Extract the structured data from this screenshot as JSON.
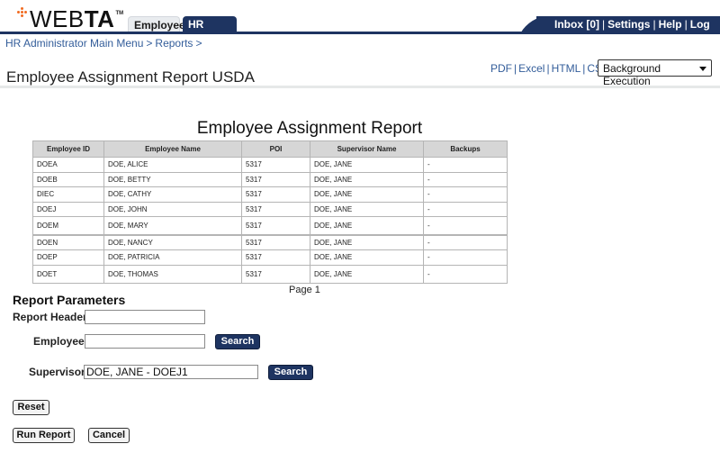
{
  "header": {
    "logo_text_thin": "WEB",
    "logo_text_bold": "TA",
    "logo_tm": "TM",
    "tabs": [
      {
        "label": "Employee",
        "active": false
      },
      {
        "label": "HR Admin",
        "active": true
      }
    ],
    "utility_links": [
      "Inbox [0]",
      "Settings",
      "Help",
      "Log Out"
    ],
    "separator": "|",
    "colors": {
      "navy": "#1e3461",
      "logo_orange": "#f26b21",
      "link_blue": "#335d9a"
    }
  },
  "breadcrumb": {
    "items": [
      "HR Administrator Main Menu",
      "Reports"
    ],
    "separator": ">"
  },
  "page_title": "Employee Assignment Report USDA",
  "exports": {
    "links": [
      "PDF",
      "Excel",
      "HTML",
      "CSV"
    ],
    "separator": "|",
    "execution_select": {
      "selected": "Background Execution"
    }
  },
  "report": {
    "title": "Employee Assignment Report",
    "columns": [
      "Employee ID",
      "Employee Name",
      "POI",
      "Supervisor Name",
      "Backups"
    ],
    "rows": [
      [
        "DOEA",
        "DOE, ALICE",
        "5317",
        "DOE, JANE",
        "-"
      ],
      [
        "DOEB",
        "DOE, BETTY",
        "5317",
        "DOE, JANE",
        "-"
      ],
      [
        "DIEC",
        "DOE, CATHY",
        "5317",
        "DOE, JANE",
        "-"
      ],
      [
        "DOEJ",
        "DOE, JOHN",
        "5317",
        "DOE, JANE",
        "-"
      ],
      [
        "DOEM",
        "DOE, MARY",
        "5317",
        "DOE, JANE",
        "-"
      ],
      [
        "DOEN",
        "DOE, NANCY",
        "5317",
        "DOE, JANE",
        "-"
      ],
      [
        "DOEP",
        "DOE, PATRICIA",
        "5317",
        "DOE, JANE",
        "-"
      ],
      [
        "DOET",
        "DOE, THOMAS",
        "5317",
        "DOE, JANE",
        "-"
      ]
    ],
    "page_label": "Page 1"
  },
  "parameters": {
    "title": "Report Parameters",
    "report_header": {
      "label": "Report Header:",
      "value": ""
    },
    "employee": {
      "label": "Employee:",
      "value": "",
      "search_label": "Search"
    },
    "supervisor": {
      "label": "Supervisor:",
      "value": "DOE, JANE - DOEJ1",
      "search_label": "Search"
    }
  },
  "actions": {
    "reset_label": "Reset",
    "run_label": "Run Report",
    "cancel_label": "Cancel"
  }
}
